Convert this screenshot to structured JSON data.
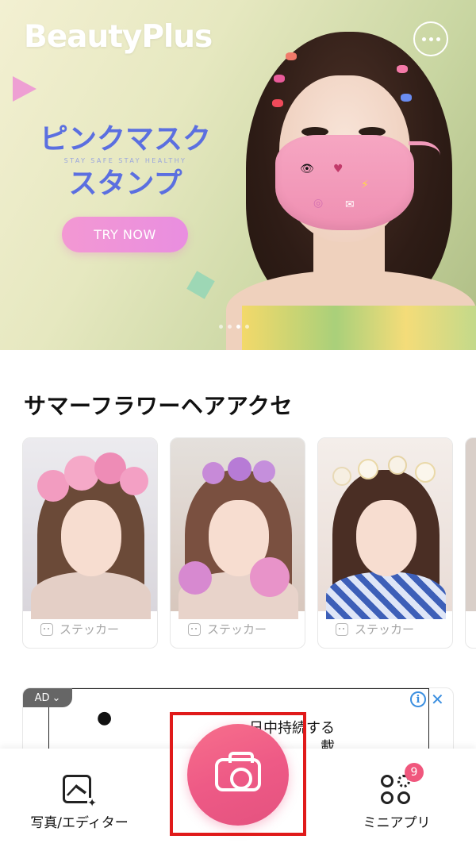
{
  "app": {
    "logo": "BeautyPlus"
  },
  "banner": {
    "title_line1": "ピンクマスク",
    "subtitle": "STAY SAFE STAY HEALTHY",
    "title_line2": "スタンプ",
    "cta": "TRY NOW",
    "page_count": 4,
    "active_page": 3,
    "colors": {
      "title": "#5b6fe0",
      "cta": "#f398d3",
      "mask": "#f6a6c2"
    }
  },
  "section": {
    "title": "サマーフラワーヘアアクセ",
    "cards": [
      {
        "label": "ステッカー",
        "icon": "sticker-icon"
      },
      {
        "label": "ステッカー",
        "icon": "sticker-icon"
      },
      {
        "label": "ステッカー",
        "icon": "sticker-icon"
      }
    ]
  },
  "ad": {
    "badge": "AD",
    "text_line1": "一日中持続する",
    "text_line2": "バッ　　　　載",
    "info_icon": "info-icon",
    "close_icon": "close-icon"
  },
  "bottom_nav": {
    "left_label": "写真/エディター",
    "right_label": "ミニアプリ",
    "right_badge": "9",
    "camera_icon": "camera-icon",
    "accent": "#ee5a86"
  }
}
